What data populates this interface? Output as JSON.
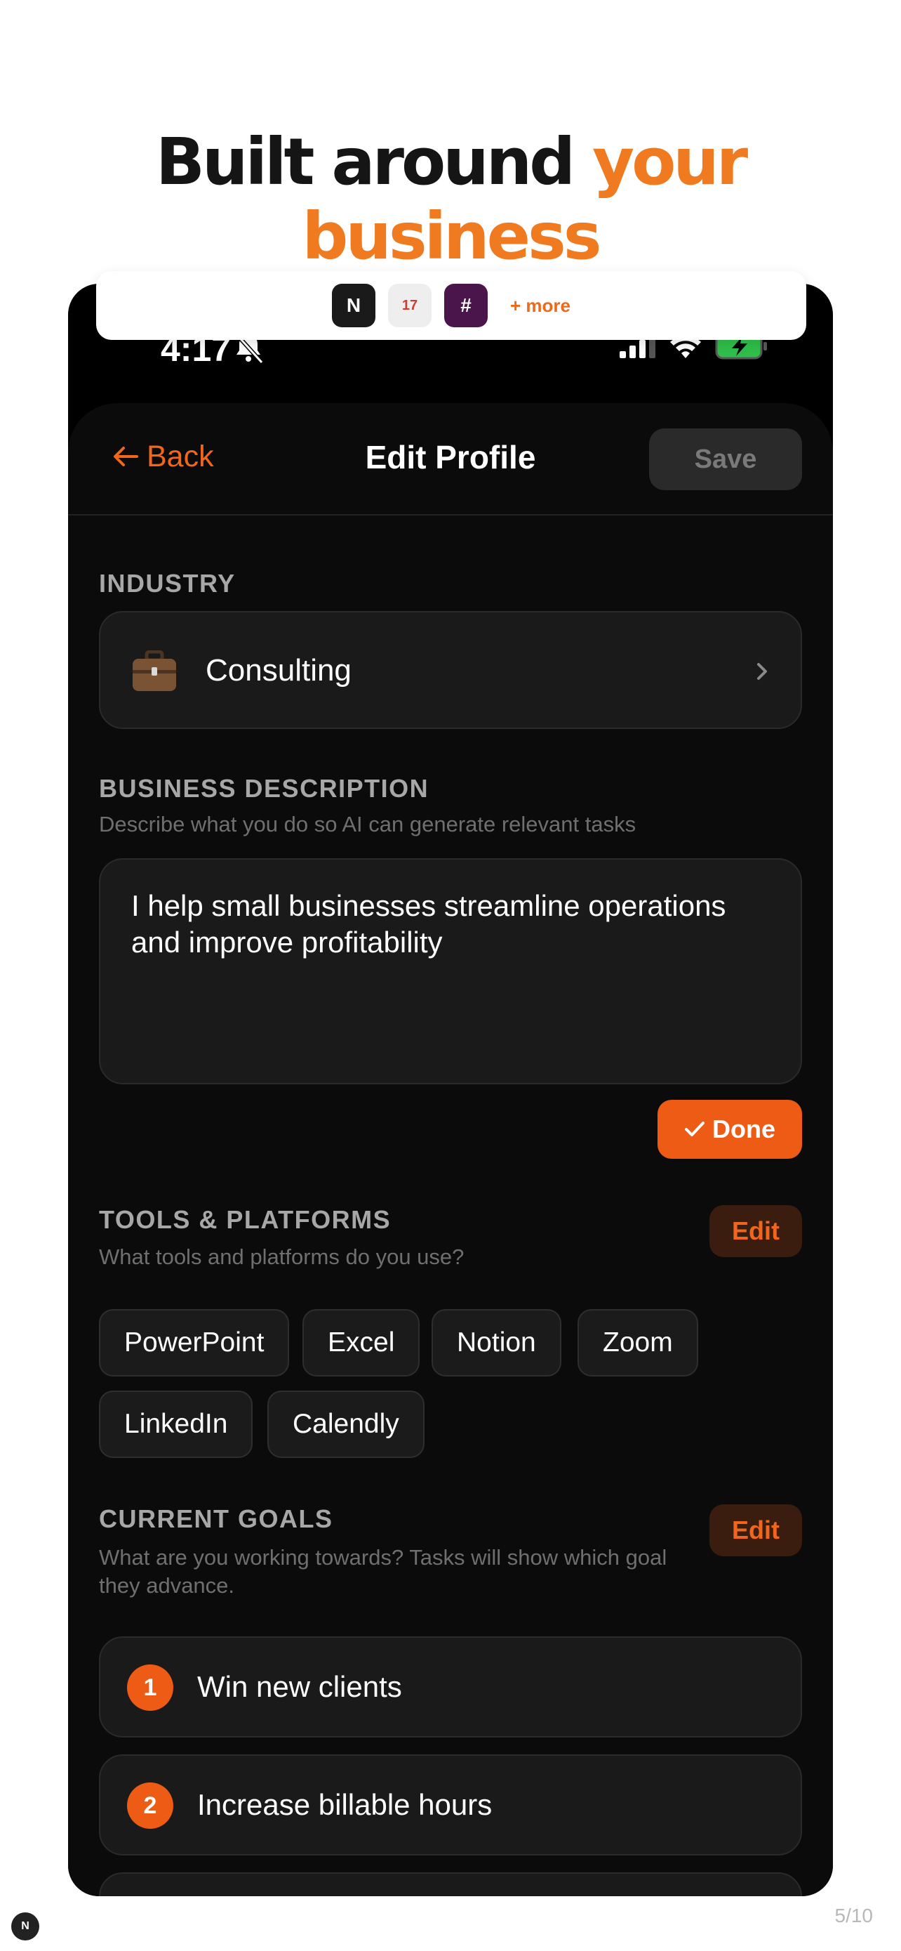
{
  "headline": {
    "line1_dark": "Built around ",
    "line1_accent": "your",
    "line2_accent": "business"
  },
  "integrations": {
    "icons": [
      {
        "name": "notion-app-icon",
        "glyph": "N"
      },
      {
        "name": "calendar-app-icon",
        "glyph": "17"
      },
      {
        "name": "slack-app-icon",
        "glyph": "#"
      }
    ],
    "more_label": "+ more"
  },
  "status_bar": {
    "time": "4:17",
    "icons": [
      "silent-bell-icon",
      "signal-icon",
      "wifi-icon",
      "battery-charging-icon"
    ]
  },
  "nav": {
    "back_label": "Back",
    "title": "Edit Profile",
    "save_label": "Save"
  },
  "industry": {
    "label": "INDUSTRY",
    "value": "Consulting",
    "icon": "briefcase-icon"
  },
  "business_description": {
    "label": "BUSINESS DESCRIPTION",
    "subtitle": "Describe what you do so AI can generate relevant tasks",
    "value": "I help small businesses streamline operations and improve profitability",
    "done_label": "Done"
  },
  "tools": {
    "label": "TOOLS & PLATFORMS",
    "subtitle": "What tools and platforms do you use?",
    "edit_label": "Edit",
    "items": [
      "PowerPoint",
      "Excel",
      "Notion",
      "Zoom",
      "LinkedIn",
      "Calendly"
    ]
  },
  "goals": {
    "label": "CURRENT GOALS",
    "subtitle": "What are you working towards? Tasks will show which goal they advance.",
    "edit_label": "Edit",
    "items": [
      {
        "number": "1",
        "text": "Win new clients"
      },
      {
        "number": "2",
        "text": "Increase billable hours"
      }
    ]
  },
  "footer": {
    "logo_glyph": "N",
    "page_indicator": "5/10"
  },
  "colors": {
    "accent": "#ee5b14",
    "headline_accent": "#f07a1f",
    "background": "#0b0b0b",
    "card": "#1a1a1a"
  }
}
